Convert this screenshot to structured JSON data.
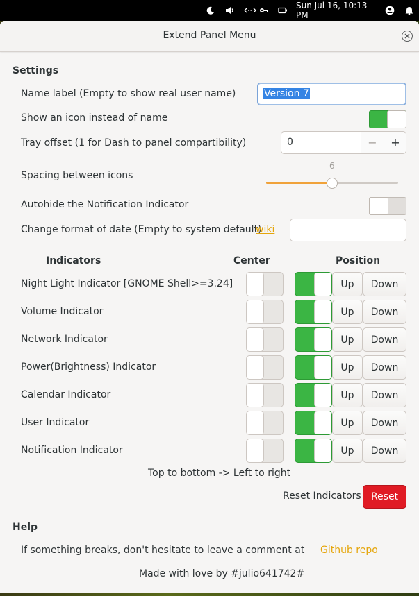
{
  "topbar": {
    "date": "Sun Jul 16, 10:13 PM"
  },
  "window": {
    "title": "Extend Panel Menu"
  },
  "settings": {
    "heading": "Settings",
    "name_label": {
      "label": "Name label (Empty to show real user name)",
      "value": "Version 7"
    },
    "show_icon": {
      "label": "Show an icon instead of name",
      "on": true
    },
    "tray_offset": {
      "label": "Tray offset (1 for Dash to panel compartibility)",
      "value": "0",
      "minus": "−",
      "plus": "+"
    },
    "spacing": {
      "label": "Spacing between icons",
      "value": "6",
      "fraction": 0.5
    },
    "autohide": {
      "label": "Autohide the Notification Indicator",
      "on": false
    },
    "date_format": {
      "label": "Change format of date (Empty to system default)",
      "link": "wiki",
      "value": ""
    }
  },
  "indicators": {
    "col_indicators": "Indicators",
    "col_center": "Center",
    "col_position": "Position",
    "up_label": "Up",
    "down_label": "Down",
    "rows": [
      {
        "name": "Night Light Indicator [GNOME Shell>=3.24]",
        "center": false,
        "enabled": true
      },
      {
        "name": "Volume Indicator",
        "center": false,
        "enabled": true
      },
      {
        "name": "Network Indicator",
        "center": false,
        "enabled": true
      },
      {
        "name": "Power(Brightness) Indicator",
        "center": false,
        "enabled": true
      },
      {
        "name": "Calendar Indicator",
        "center": false,
        "enabled": true
      },
      {
        "name": "User Indicator",
        "center": false,
        "enabled": true
      },
      {
        "name": "Notification Indicator",
        "center": false,
        "enabled": true
      }
    ],
    "note": "Top to bottom -> Left to right",
    "reset_label": "Reset Indicators",
    "reset_button": "Reset"
  },
  "help": {
    "heading": "Help",
    "text": "If something breaks, don't hesitate to leave a comment at",
    "link": "Github repo",
    "footer": "Made with love by #julio641742#"
  },
  "colors": {
    "accent_green": "#3bb544",
    "destructive_red": "#e01b24",
    "link_orange": "#e5a50a",
    "slider_orange": "#f0a23a"
  },
  "icons": [
    "moon-icon",
    "volume-icon",
    "network-icon",
    "key-icon",
    "battery-icon",
    "user-icon",
    "bell-icon",
    "close-icon"
  ]
}
